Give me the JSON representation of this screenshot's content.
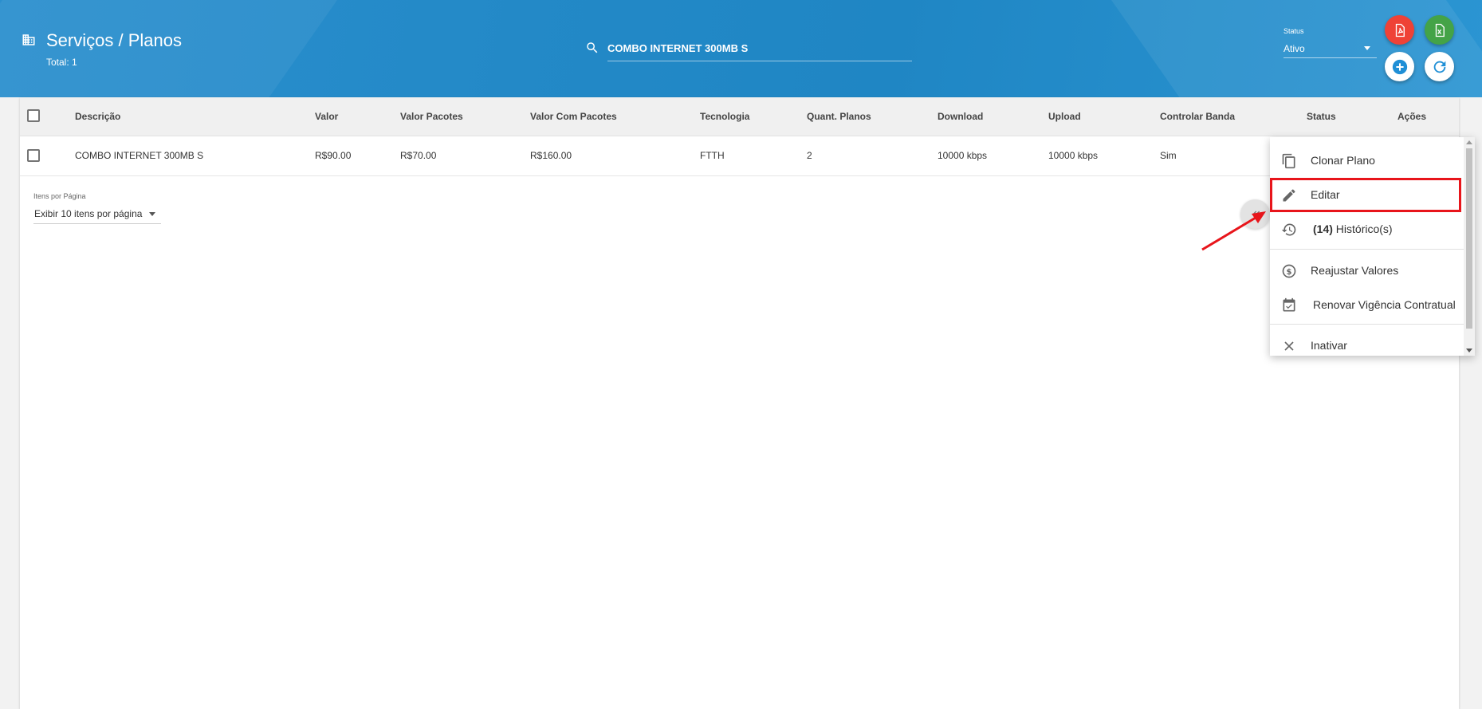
{
  "header": {
    "title": "Serviços / Planos",
    "total": "Total: 1",
    "search_value": "COMBO INTERNET 300MB S",
    "status_label": "Status",
    "status_value": "Ativo"
  },
  "table": {
    "columns": [
      "Descrição",
      "Valor",
      "Valor Pacotes",
      "Valor Com Pacotes",
      "Tecnologia",
      "Quant. Planos",
      "Download",
      "Upload",
      "Controlar Banda",
      "Status",
      "Ações"
    ],
    "rows": [
      [
        "COMBO INTERNET 300MB S",
        "R$90.00",
        "R$70.00",
        "R$160.00",
        "FTTH",
        "2",
        "10000 kbps",
        "10000 kbps",
        "Sim"
      ]
    ]
  },
  "pagination": {
    "label": "Itens por Página",
    "value": "Exibir 10 itens por página"
  },
  "menu": {
    "clone": "Clonar Plano",
    "edit": "Editar",
    "history_count": "(14)",
    "history": " Histórico(s)",
    "adjust": "Reajustar Valores",
    "renew": "Renovar Vigência Contratual",
    "inactivate": "Inativar"
  },
  "colors": {
    "header_blue": "#2389c7",
    "pdf_red": "#ef4236",
    "excel_green": "#44a347",
    "highlight_red": "#e8151b"
  }
}
